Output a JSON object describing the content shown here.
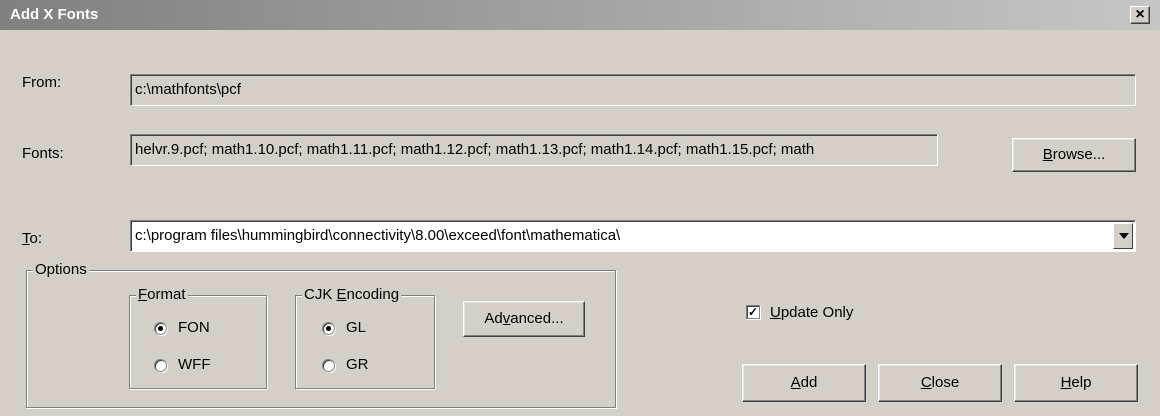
{
  "window": {
    "title": "Add X Fonts"
  },
  "from": {
    "label": "From:",
    "value": "c:\\mathfonts\\pcf"
  },
  "fonts": {
    "label": "Fonts:",
    "value": "helvr.9.pcf; math1.10.pcf; math1.11.pcf; math1.12.pcf; math1.13.pcf; math1.14.pcf; math1.15.pcf; math"
  },
  "browse": {
    "pre": "",
    "key": "B",
    "post": "rowse..."
  },
  "to": {
    "key": "T",
    "post": "o:",
    "value": "c:\\program files\\hummingbird\\connectivity\\8.00\\exceed\\font\\mathematica\\"
  },
  "options": {
    "legend": "Options",
    "format": {
      "legend_key": "F",
      "legend_post": "ormat",
      "items": [
        "FON",
        "WFF"
      ],
      "selected": "FON"
    },
    "cjk": {
      "legend_pre": "CJK ",
      "legend_key": "E",
      "legend_post": "ncoding",
      "items": [
        "GL",
        "GR"
      ],
      "selected": "GL"
    },
    "advanced": {
      "pre": "Ad",
      "key": "v",
      "post": "anced..."
    }
  },
  "update_only": {
    "key": "U",
    "post": "pdate Only",
    "checked": true
  },
  "buttons": {
    "add": {
      "key": "A",
      "post": "dd"
    },
    "close": {
      "key": "C",
      "post": "lose"
    },
    "help": {
      "key": "H",
      "post": "elp"
    }
  }
}
